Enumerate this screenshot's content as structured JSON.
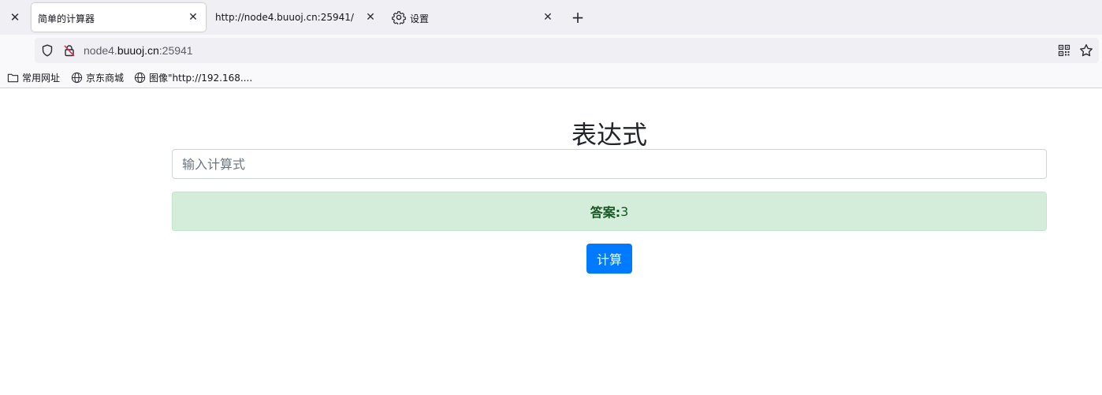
{
  "browser": {
    "tabs": [
      {
        "title": "简单的计算器",
        "active": true
      },
      {
        "title": "http://node4.buuoj.cn:25941/",
        "active": false
      },
      {
        "title": "设置",
        "active": false,
        "icon": "gear-icon"
      }
    ],
    "close_glyph": "✕",
    "newtab_glyph": "+",
    "url": {
      "prefix": "node4.",
      "host": "buuoj.cn",
      "suffix": ":25941"
    },
    "bookmarks": [
      {
        "label": "常用网址",
        "icon": "folder-icon"
      },
      {
        "label": "京东商城",
        "icon": "globe-icon"
      },
      {
        "label": "图像\"http://192.168....",
        "icon": "globe-icon"
      }
    ]
  },
  "page": {
    "title": "表达式",
    "input": {
      "placeholder": "输入计算式",
      "value": ""
    },
    "answer": {
      "label": "答案:",
      "value": "3"
    },
    "button_label": "计算"
  },
  "colors": {
    "primary": "#007bff",
    "success_bg": "#d4edda",
    "success_text": "#155724"
  }
}
